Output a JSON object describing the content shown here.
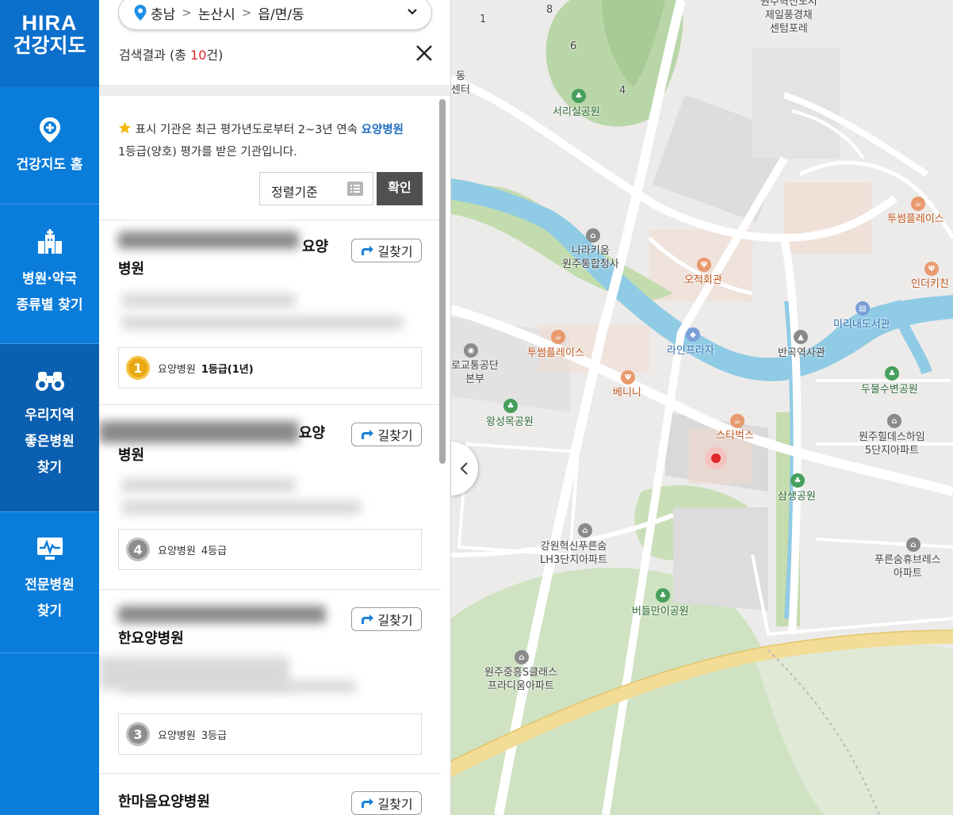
{
  "logo": {
    "line1": "HIRA",
    "line2": "건강지도"
  },
  "nav": [
    {
      "label": "건강지도 홈",
      "icon": "map-pin-plus-icon"
    },
    {
      "label": "병원·약국\n종류별 찾기",
      "icon": "hospital-building-icon"
    },
    {
      "label": "우리지역\n좋은병원\n찾기",
      "icon": "binoculars-icon"
    },
    {
      "label": "전문병원\n찾기",
      "icon": "monitor-heartbeat-icon"
    }
  ],
  "location": {
    "province": "충남",
    "city": "논산시",
    "district": "읍/면/동"
  },
  "results": {
    "prefix": "검색결과 (총 ",
    "count": "10",
    "suffix": "건)"
  },
  "notice": {
    "part1": "표시 기관은 최근 평가년도로부터 2~3년 연속 ",
    "highlight": "요양병원",
    "part2": "1등급(양호) 평가를 받은 기관입니다."
  },
  "sort": {
    "label": "정렬기준",
    "confirm": "확인"
  },
  "route_label": "길찾기",
  "cards": [
    {
      "name_visible": "요양",
      "name_line2": "병원",
      "grade_type": "요양병원",
      "grade_value": "1등급(1년)",
      "badge": "1"
    },
    {
      "name_visible": "요양",
      "name_line2": "병원",
      "grade_type": "요양병원",
      "grade_value": "4등급",
      "badge": "4"
    },
    {
      "name_line2": "한요양병원",
      "grade_type": "요양병원",
      "grade_value": "3등급",
      "badge": "3"
    },
    {
      "name": "한마음요양병원"
    }
  ],
  "map_labels": {
    "seorisil": "서리실공원",
    "narakium": "나라키움\n원주통합청사",
    "ojeok": "오적회관",
    "twosome1": "투썸플레이스",
    "indeokitchen": "인더키친",
    "mirinae": "미리내도서관",
    "lineplaza": "라인프라자",
    "bangok": "반곡역사관",
    "twosome2": "투썸플레이스",
    "benny": "베니니",
    "roadcorp": "로교통공단\n본부",
    "dumulsu": "두물수변공원",
    "wangseong": "왕성목공원",
    "starbucks": "스타벅스",
    "hillstate": "원주힐데스하임\n5단지아파트",
    "samsaeng": "삼생공원",
    "lh3": "강원혁신푸른숨\nLH3단지아파트",
    "pureunsum": "푸른숨휴브레스\n아파트",
    "beodeul": "버들만이공원",
    "sclass": "원주중흥S클래스\n프라디움아파트",
    "top": "원주혁신도시\n제일풍경채\n센텀포레",
    "dong": "동\n센터",
    "n1": "1",
    "n8": "8",
    "n6": "6",
    "n4": "4"
  }
}
